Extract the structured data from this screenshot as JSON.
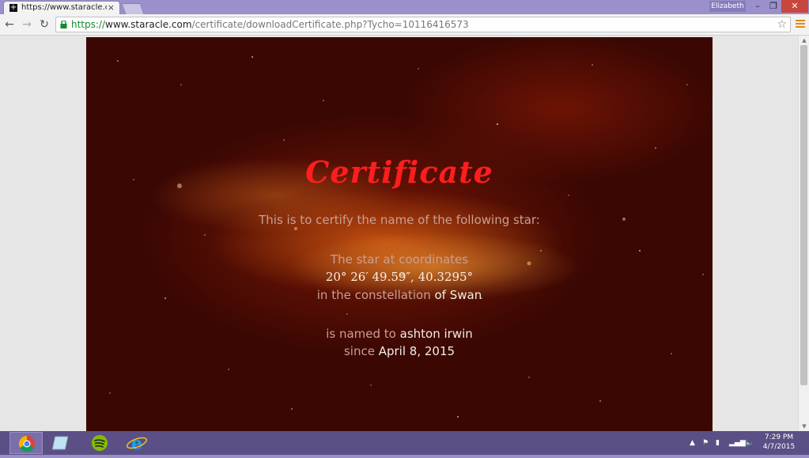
{
  "browser": {
    "tab_title": "https://www.staracle.com",
    "tab_favicon": "+",
    "close_glyph": "×",
    "user": "Elizabeth",
    "url_scheme": "https://",
    "url_domain": "www.staracle.com",
    "url_path": "/certificate/downloadCertificate.php?Tycho=10116416573",
    "controls": {
      "minimize": "–",
      "maximize": "❐",
      "close": "✕"
    },
    "nav": {
      "back": "←",
      "forward": "→",
      "reload": "↻",
      "bookmark": "☆"
    }
  },
  "certificate": {
    "title": "Certificate",
    "intro": "This is to certify the name of the following star:",
    "star_at": "The star at coordinates",
    "coordinates": "20° 26′ 49.59″, 40.3295°",
    "constellation_prefix": "in the constellation",
    "constellation": "of Swan",
    "named_prefix": "is named to",
    "name": "ashton irwin",
    "since_prefix": "since",
    "date": "April 8, 2015"
  },
  "taskbar": {
    "apps": [
      "chrome-icon",
      "files-icon",
      "spotify-icon",
      "internet-explorer-icon"
    ],
    "time": "7:29 PM",
    "date": "4/7/2015"
  },
  "colors": {
    "title_red": "#ff1e1e",
    "accent": "#9b90cc"
  }
}
